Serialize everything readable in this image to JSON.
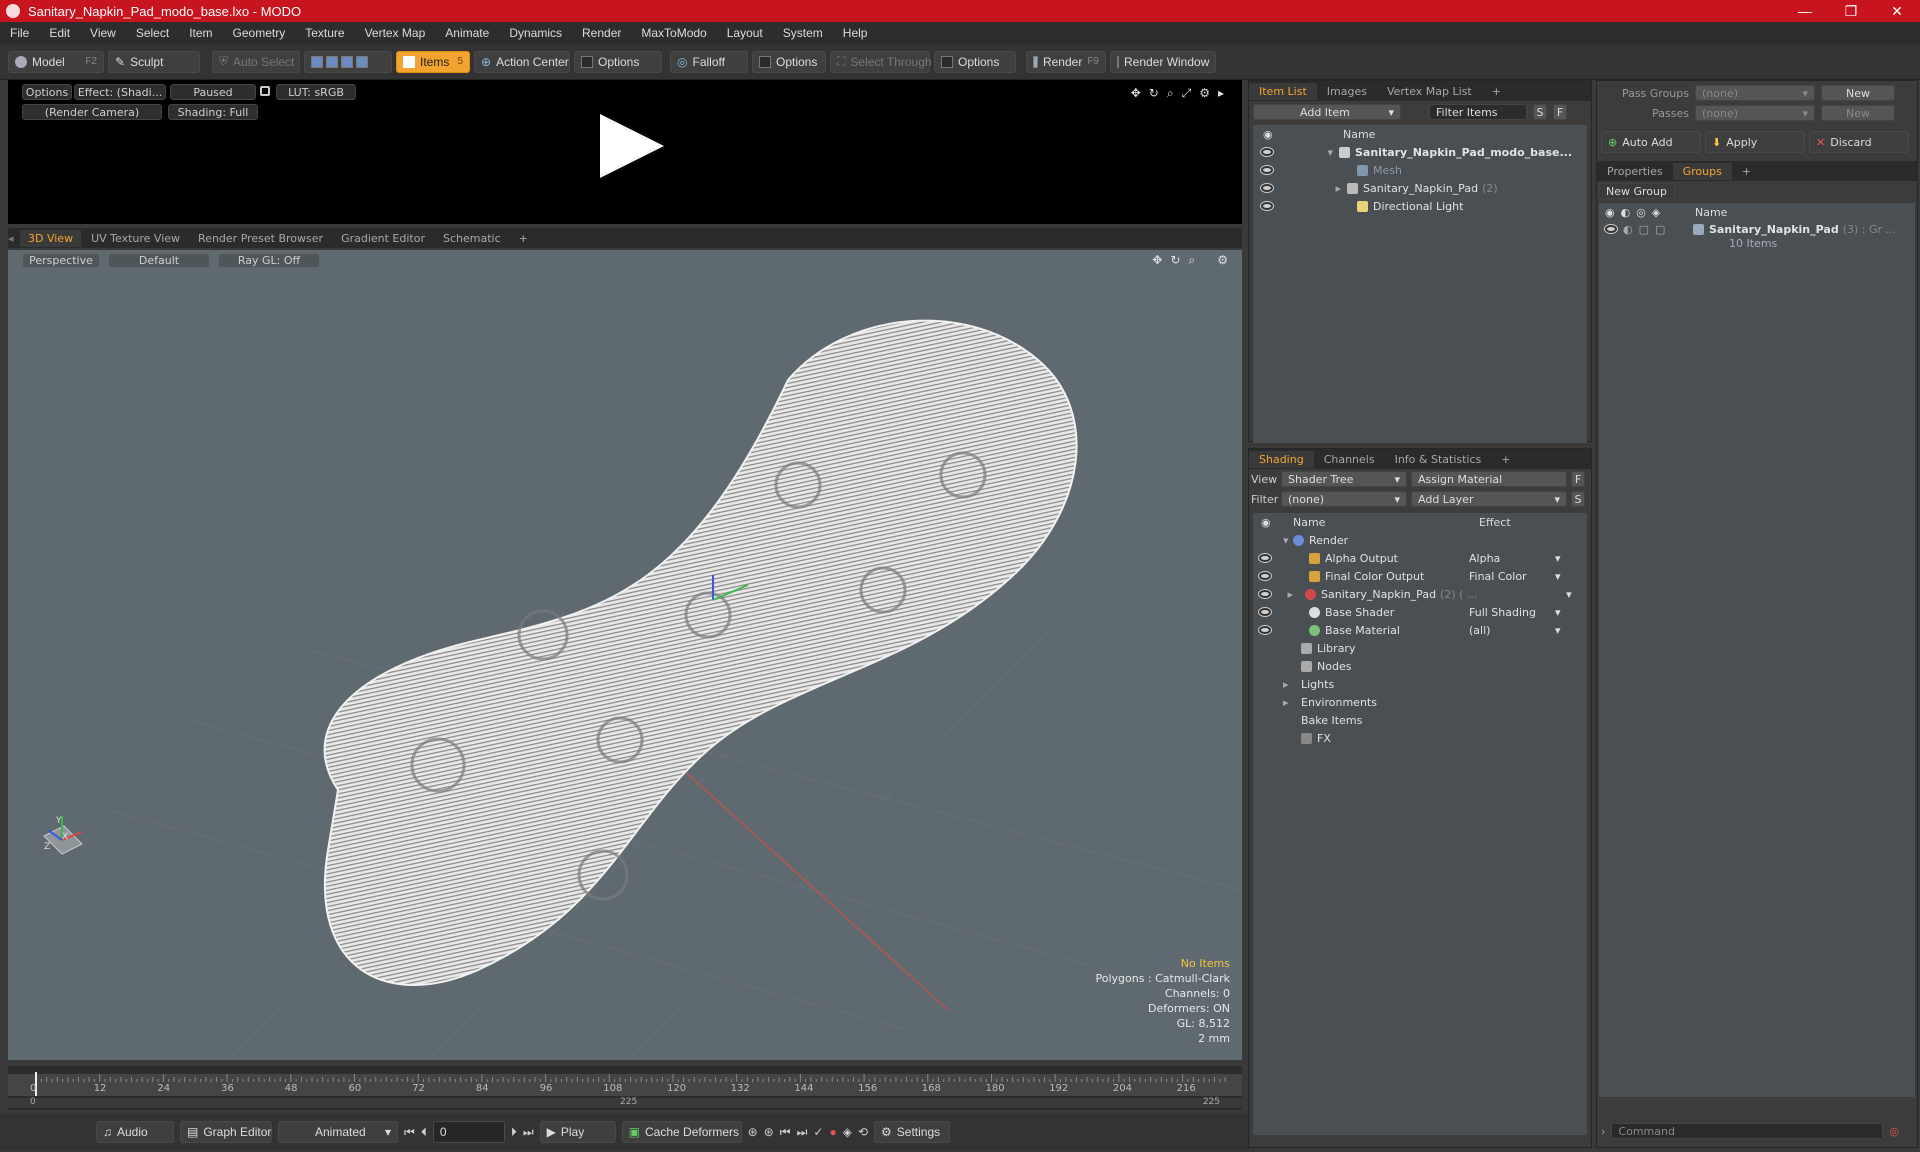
{
  "window": {
    "title": "Sanitary_Napkin_Pad_modo_base.lxo - MODO",
    "minimize": "—",
    "maximize": "❐",
    "close": "✕"
  },
  "menu": [
    "File",
    "Edit",
    "View",
    "Select",
    "Item",
    "Geometry",
    "Texture",
    "Vertex Map",
    "Animate",
    "Dynamics",
    "Render",
    "MaxToModo",
    "Layout",
    "System",
    "Help"
  ],
  "toolbar": {
    "model": "Model",
    "model_key": "F2",
    "sculpt": "Sculpt",
    "auto_select": "Auto Select",
    "items": "Items",
    "items_key": "5",
    "action_center": "Action Center",
    "options1": "Options",
    "falloff": "Falloff",
    "options2": "Options",
    "select_through": "Select Through",
    "options3": "Options",
    "render": "Render",
    "render_key": "F9",
    "render_window": "Render Window"
  },
  "render_panel": {
    "options": "Options",
    "effect": "Effect: (Shadi...",
    "paused": "Paused",
    "lut": "LUT: sRGB",
    "camera": "(Render Camera)",
    "shading": "Shading: Full"
  },
  "viewport_tabs": [
    "3D View",
    "UV Texture View",
    "Render Preset Browser",
    "Gradient Editor",
    "Schematic",
    "+"
  ],
  "viewport": {
    "perspective": "Perspective",
    "default": "Default",
    "raygl": "Ray GL: Off",
    "stats": {
      "no_items": "No Items",
      "polygons": "Polygons : Catmull-Clark",
      "channels": "Channels: 0",
      "deformers": "Deformers: ON",
      "gl": "GL: 8,512",
      "scale": "2 mm"
    },
    "axis_x": "X",
    "axis_y": "Y",
    "axis_z": "Z"
  },
  "timeline": {
    "ticks": [
      "0",
      "12",
      "24",
      "36",
      "48",
      "60",
      "72",
      "84",
      "96",
      "108",
      "120",
      "132",
      "144",
      "156",
      "168",
      "180",
      "192",
      "204",
      "216"
    ],
    "start": "0",
    "mid": "225",
    "end": "225"
  },
  "bottombar": {
    "audio": "Audio",
    "graph_editor": "Graph Editor",
    "animated": "Animated",
    "frame": "0",
    "play": "Play",
    "cache": "Cache Deformers",
    "settings": "Settings"
  },
  "item_list": {
    "tabs": [
      "Item List",
      "Images",
      "Vertex Map List",
      "+"
    ],
    "add_item": "Add Item",
    "filter": "Filter Items",
    "s": "S",
    "f": "F",
    "name_col": "Name",
    "rows": [
      {
        "label": "Sanitary_Napkin_Pad_modo_base..."
      },
      {
        "label": "Mesh"
      },
      {
        "label": "Sanitary_Napkin_Pad",
        "count": "(2)"
      },
      {
        "label": "Directional Light"
      }
    ]
  },
  "shading": {
    "tabs": [
      "Shading",
      "Channels",
      "Info & Statistics",
      "+"
    ],
    "view_label": "View",
    "view_value": "Shader Tree",
    "assign": "Assign Material",
    "f": "F",
    "filter_label": "Filter",
    "filter_value": "(none)",
    "add_layer": "Add Layer",
    "s": "S",
    "name_col": "Name",
    "effect_col": "Effect",
    "rows": [
      {
        "label": "Render",
        "effect": ""
      },
      {
        "label": "Alpha Output",
        "effect": "Alpha"
      },
      {
        "label": "Final Color Output",
        "effect": "Final Color"
      },
      {
        "label": "Sanitary_Napkin_Pad",
        "count": "(2) ( ...",
        "effect": ""
      },
      {
        "label": "Base Shader",
        "effect": "Full Shading"
      },
      {
        "label": "Base Material",
        "effect": "(all)"
      },
      {
        "label": "Library",
        "effect": ""
      },
      {
        "label": "Nodes",
        "effect": ""
      },
      {
        "label": "Lights",
        "effect": ""
      },
      {
        "label": "Environments",
        "effect": ""
      },
      {
        "label": "Bake Items",
        "effect": ""
      },
      {
        "label": "FX",
        "effect": ""
      }
    ]
  },
  "right_panel": {
    "pass_groups": "Pass Groups",
    "pass_groups_value": "(none)",
    "new": "New",
    "passes": "Passes",
    "passes_value": "(none)",
    "new2": "New",
    "auto_add": "Auto Add",
    "apply": "Apply",
    "discard": "Discard",
    "tabs": [
      "Properties",
      "Groups",
      "+"
    ],
    "new_group": "New Group",
    "name_col": "Name",
    "group_name": "Sanitary_Napkin_Pad",
    "group_count": "(3) : Gr ...",
    "group_items": "10 Items",
    "command": "Command"
  }
}
